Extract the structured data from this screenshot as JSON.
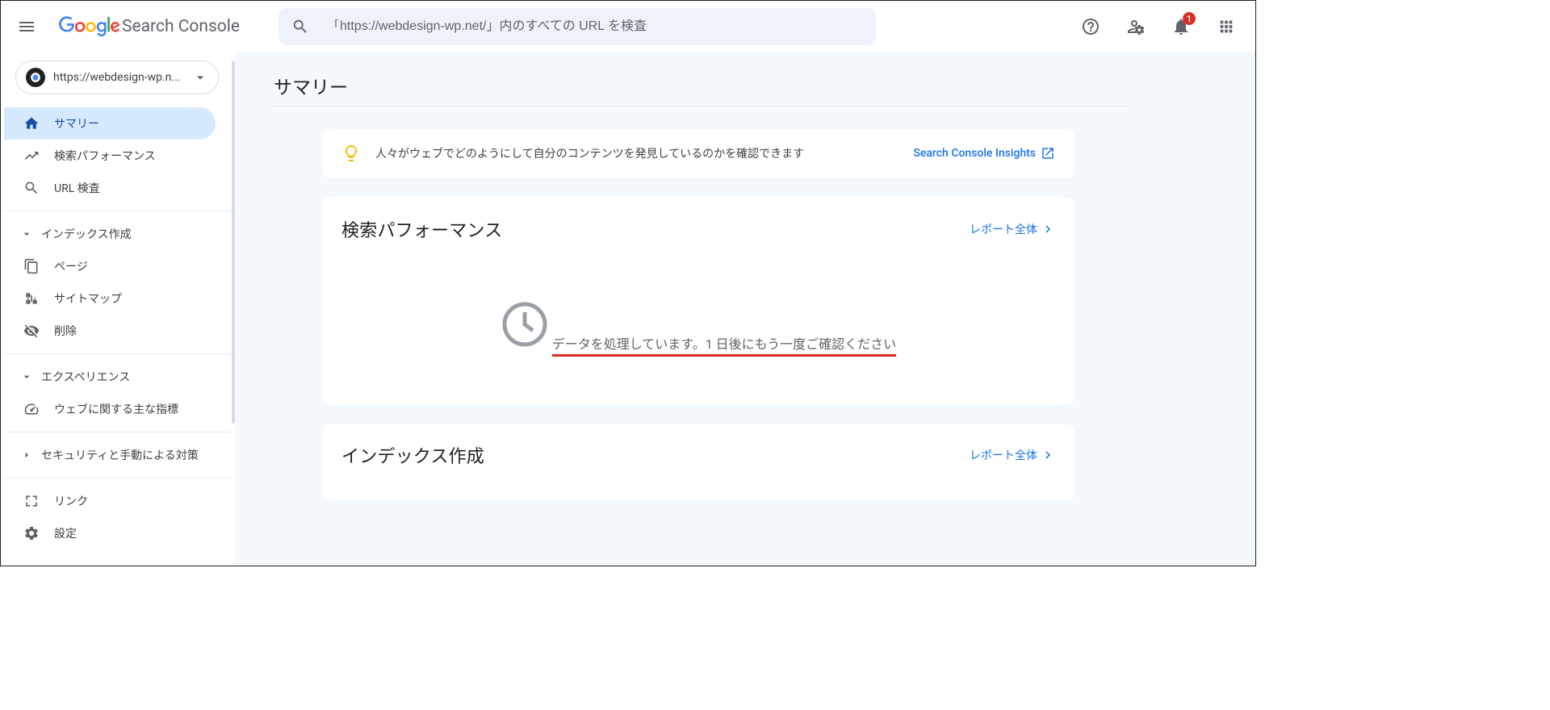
{
  "header": {
    "logo_brand_text": "Search Console",
    "search_placeholder": "「https://webdesign-wp.net/」内のすべての URL を検査",
    "notification_count": "1"
  },
  "property": {
    "label": "https://webdesign-wp.n..."
  },
  "sidebar": {
    "summary": "サマリー",
    "search_perf": "検索パフォーマンス",
    "url_inspect": "URL 検査",
    "group_index": "インデックス作成",
    "pages": "ページ",
    "sitemaps": "サイトマップ",
    "removals": "削除",
    "group_experience": "エクスペリエンス",
    "core_web_vitals": "ウェブに関する主な指標",
    "group_security": "セキュリティと手動による対策",
    "links": "リンク",
    "settings": "設定"
  },
  "main": {
    "page_title": "サマリー",
    "insight_message": "人々がウェブでどのようにして自分のコンテンツを発見しているのかを確認できます",
    "insight_link_label": "Search Console Insights",
    "perf_card_title": "検索パフォーマンス",
    "perf_full_report": "レポート全体",
    "processing_message": "データを処理しています。1 日後にもう一度ご確認ください",
    "index_card_title": "インデックス作成",
    "index_full_report": "レポート全体"
  }
}
